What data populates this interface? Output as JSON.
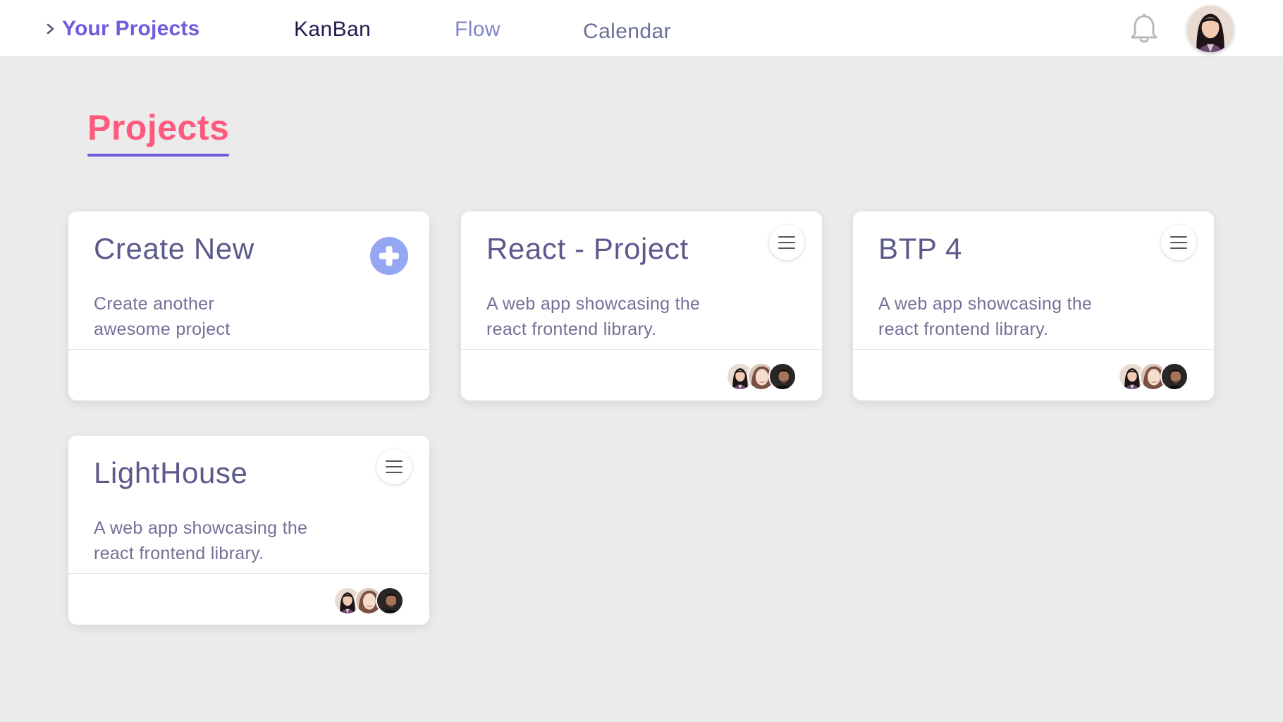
{
  "header": {
    "breadcrumb": "Your Projects",
    "tabs": [
      {
        "label": "KanBan"
      },
      {
        "label": "Flow"
      },
      {
        "label": "Calendar"
      }
    ],
    "notification_icon": "bell-icon",
    "accent_color": "#7358e0"
  },
  "main": {
    "title": "Projects",
    "title_color": "#ff5a7d",
    "cards": [
      {
        "title": "Create New",
        "description": "Create another awesome project",
        "action_icon": "plus-circle-icon"
      },
      {
        "title": "React - Project",
        "description": "A web app showcasing the react frontend library.",
        "action_icon": "menu-icon"
      },
      {
        "title": "BTP 4",
        "description": "A web app showcasing the react frontend library.",
        "action_icon": "menu-icon"
      },
      {
        "title": "LightHouse",
        "description": "A web app showcasing the react frontend library.",
        "action_icon": "menu-icon"
      }
    ]
  }
}
